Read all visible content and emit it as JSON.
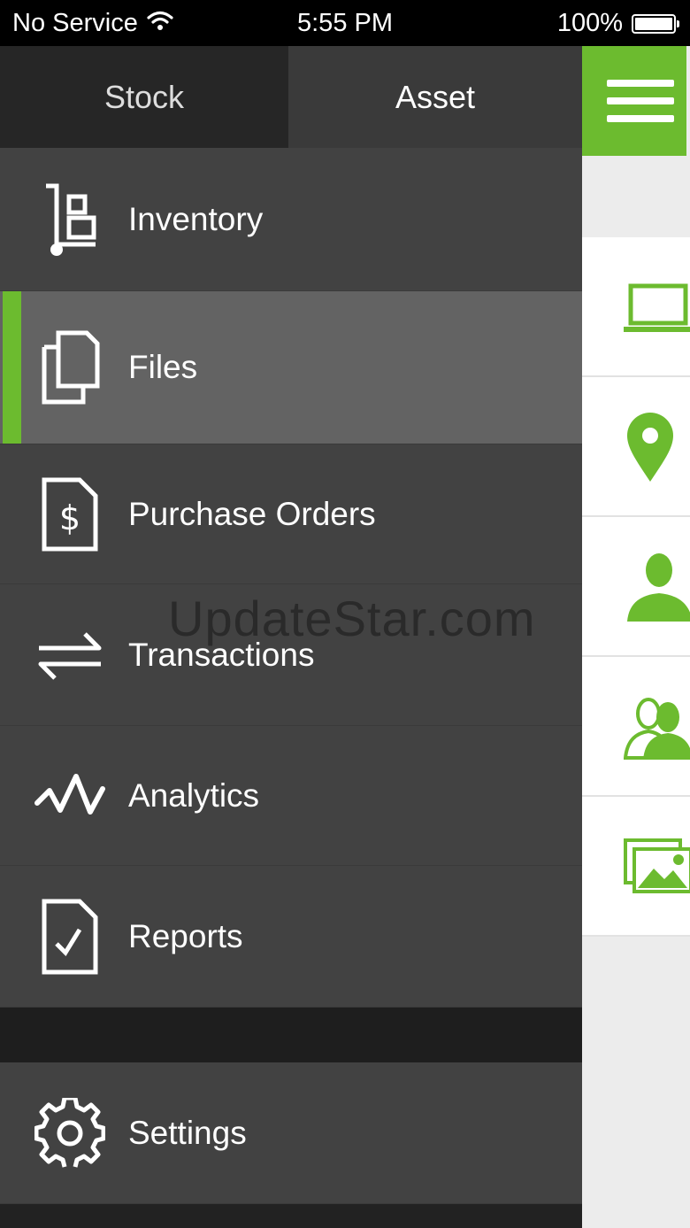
{
  "status_bar": {
    "carrier": "No Service",
    "time": "5:55 PM",
    "battery": "100%"
  },
  "tabs": [
    {
      "label": "Stock",
      "selected": false
    },
    {
      "label": "Asset",
      "selected": true
    }
  ],
  "menu": {
    "items": [
      {
        "label": "Inventory",
        "icon": "inventory-icon"
      },
      {
        "label": "Files",
        "icon": "files-icon",
        "active": true
      },
      {
        "label": "Purchase Orders",
        "icon": "purchase-order-icon"
      },
      {
        "label": "Transactions",
        "icon": "transactions-icon"
      },
      {
        "label": "Analytics",
        "icon": "analytics-icon"
      },
      {
        "label": "Reports",
        "icon": "reports-icon"
      }
    ],
    "settings_label": "Settings"
  },
  "right_pane": {
    "icons": [
      "laptop-icon",
      "location-pin-icon",
      "person-icon",
      "people-icon",
      "images-icon"
    ]
  },
  "watermark": "UpdateStar.com",
  "colors": {
    "accent": "#6cbb2f",
    "menu_bg": "#424242",
    "menu_active_bg": "#636363"
  }
}
